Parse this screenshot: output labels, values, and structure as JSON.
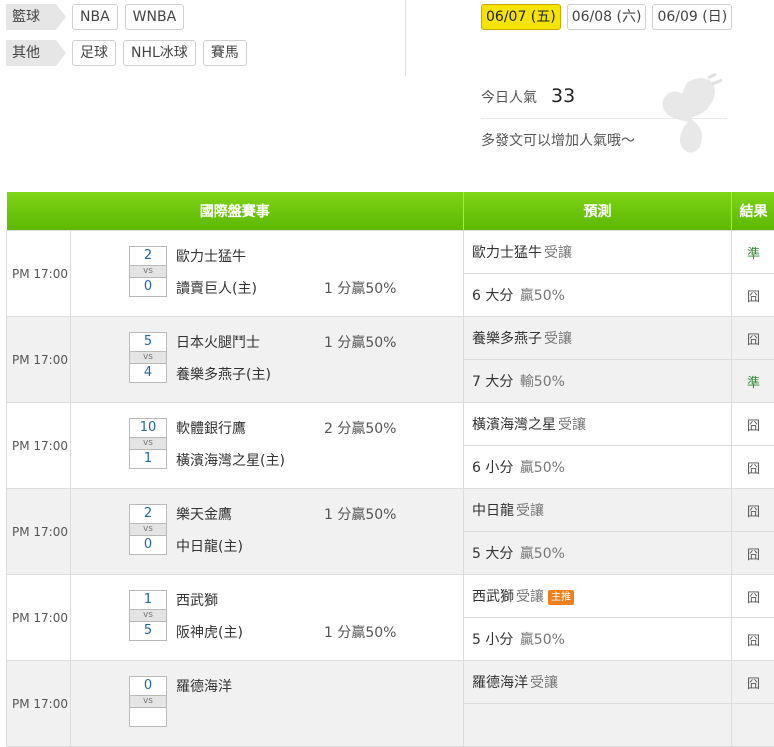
{
  "categories": [
    {
      "label": "籃球",
      "tags": [
        "NBA",
        "WNBA"
      ]
    },
    {
      "label": "其他",
      "tags": [
        "足球",
        "NHL冰球",
        "賽馬"
      ]
    }
  ],
  "dates": [
    {
      "label": "06/07 (五)",
      "active": true
    },
    {
      "label": "06/08 (六)",
      "active": false
    },
    {
      "label": "06/09 (日)",
      "active": false
    }
  ],
  "popularity": {
    "label": "今日人氣",
    "value": "33",
    "note": "多發文可以增加人氣哦～"
  },
  "table": {
    "headers": {
      "event": "國際盤賽事",
      "prediction": "預測",
      "result": "結果"
    },
    "matches": [
      {
        "time": "PM 17:00",
        "s1": "2",
        "s2": "0",
        "vs": "vs",
        "t1": "歐力士猛牛",
        "t2": "讀賣巨人(主)",
        "hd1": "",
        "hd2": "1 分贏50%",
        "p1": "歐力士猛牛",
        "p1s": "受讓",
        "p1b": "",
        "r1": "準",
        "p2": "6 大分",
        "p2s": "贏50%",
        "r2": "囧"
      },
      {
        "time": "PM 17:00",
        "s1": "5",
        "s2": "4",
        "vs": "vs",
        "t1": "日本火腿鬥士",
        "t2": "養樂多燕子(主)",
        "hd1": "1 分贏50%",
        "hd2": "",
        "p1": "養樂多燕子",
        "p1s": "受讓",
        "p1b": "",
        "r1": "囧",
        "p2": "7 大分",
        "p2s": "輸50%",
        "r2": "準"
      },
      {
        "time": "PM 17:00",
        "s1": "10",
        "s2": "1",
        "vs": "vs",
        "t1": "軟體銀行鷹",
        "t2": "橫濱海灣之星(主)",
        "hd1": "2 分贏50%",
        "hd2": "",
        "p1": "橫濱海灣之星",
        "p1s": "受讓",
        "p1b": "",
        "r1": "囧",
        "p2": "6 小分",
        "p2s": "贏50%",
        "r2": "囧"
      },
      {
        "time": "PM 17:00",
        "s1": "2",
        "s2": "0",
        "vs": "vs",
        "t1": "樂天金鷹",
        "t2": "中日龍(主)",
        "hd1": "1 分贏50%",
        "hd2": "",
        "p1": "中日龍",
        "p1s": "受讓",
        "p1b": "",
        "r1": "囧",
        "p2": "5 大分",
        "p2s": "贏50%",
        "r2": "囧"
      },
      {
        "time": "PM 17:00",
        "s1": "1",
        "s2": "5",
        "vs": "vs",
        "t1": "西武獅",
        "t2": "阪神虎(主)",
        "hd1": "",
        "hd2": "1 分贏50%",
        "p1": "西武獅",
        "p1s": "受讓",
        "p1b": "主推",
        "r1": "囧",
        "p2": "5 小分",
        "p2s": "贏50%",
        "r2": "囧"
      },
      {
        "time": "PM 17:00",
        "s1": "0",
        "s2": "",
        "vs": "vs",
        "t1": "羅德海洋",
        "t2": "",
        "hd1": "",
        "hd2": "",
        "p1": "羅德海洋",
        "p1s": "受讓",
        "p1b": "",
        "r1": "囧",
        "p2": "",
        "p2s": "",
        "r2": ""
      }
    ]
  }
}
